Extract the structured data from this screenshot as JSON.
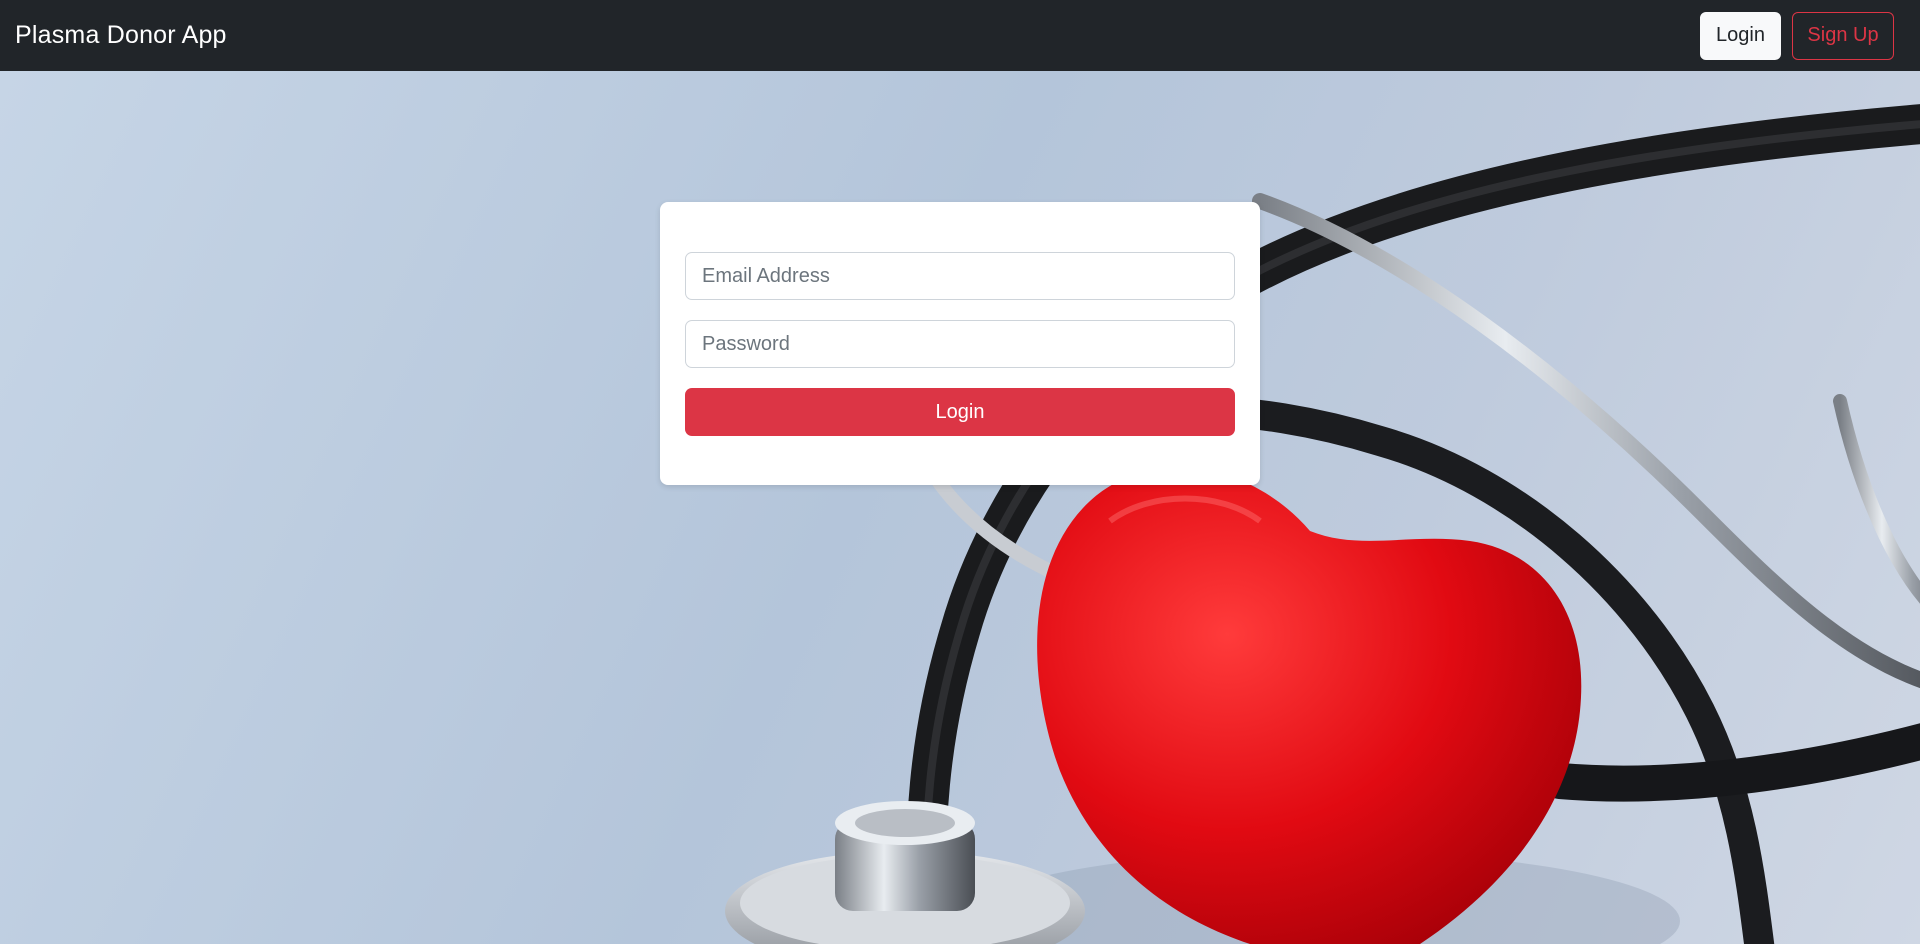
{
  "navbar": {
    "brand": "Plasma Donor App",
    "login_label": "Login",
    "signup_label": "Sign Up"
  },
  "login_form": {
    "email_placeholder": "Email Address",
    "password_placeholder": "Password",
    "submit_label": "Login"
  },
  "colors": {
    "navbar_bg": "#212529",
    "accent_red": "#dc3545",
    "light_button": "#f8f9fa"
  }
}
